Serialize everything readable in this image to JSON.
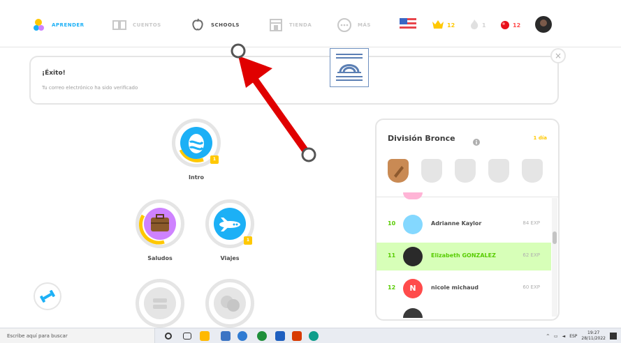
{
  "nav": {
    "learn": "APRENDER",
    "stories": "CUENTOS",
    "schools": "SCHOOLS",
    "shop": "TIENDA",
    "more": "MÁS"
  },
  "stats": {
    "crowns": "12",
    "streak": "1",
    "gems": "12"
  },
  "banner": {
    "title": "¡Éxito!",
    "text": "Tu correo electrónico ha sido verificado"
  },
  "skills": [
    {
      "label": "Intro",
      "level": "1"
    },
    {
      "label": "Saludos"
    },
    {
      "label": "Viajes",
      "level": "1"
    }
  ],
  "league": {
    "title": "División Bronce",
    "days": "1 día",
    "rows": [
      {
        "rank": "10",
        "avatar": "",
        "name": "Adrianne Kaylor",
        "xp": "84 EXP"
      },
      {
        "rank": "11",
        "avatar": "",
        "name": "Elizabeth GONZALEZ",
        "xp": "62 EXP"
      },
      {
        "rank": "12",
        "avatar": "N",
        "name": "nicole michaud",
        "xp": "60 EXP"
      }
    ]
  },
  "taskbar": {
    "search_placeholder": "Escribe aquí para buscar",
    "lang": "ESP",
    "time": "19:27",
    "date": "28/11/2022"
  },
  "colors": {
    "accent": "#1cb0f6",
    "green": "#58cc02",
    "gold": "#ffc800",
    "red_arrow": "#ff0000"
  }
}
